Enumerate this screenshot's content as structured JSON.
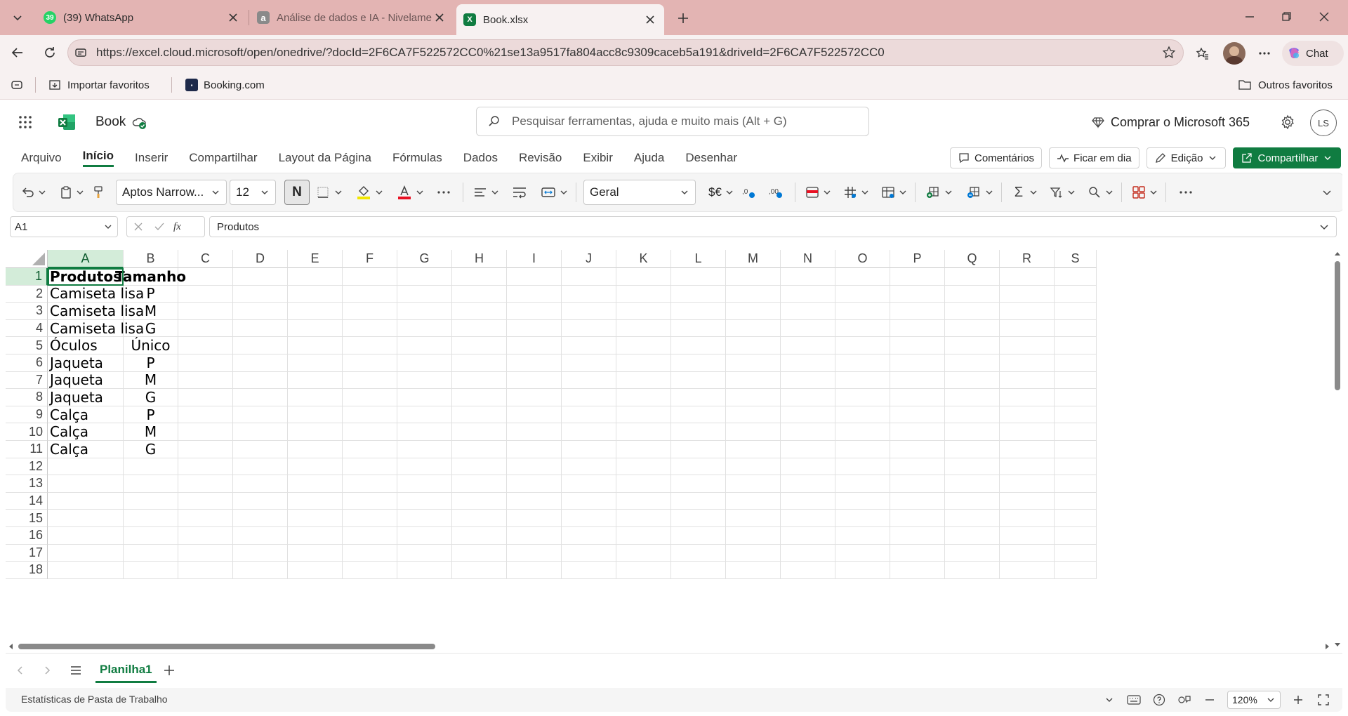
{
  "browser": {
    "tabs": [
      {
        "badge": "39",
        "title": "(39) WhatsApp"
      },
      {
        "title": "Análise de dados e IA - Nivelamen"
      },
      {
        "title": "Book.xlsx"
      }
    ],
    "url": "https://excel.cloud.microsoft/open/onedrive/?docId=2F6CA7F522572CC0%21se13a9517fa804acc8c9309caceb5a191&driveId=2F6CA7F522572CC0",
    "copilot_label": "Chat",
    "favorites": [
      "Importar favoritos",
      "Booking.com"
    ],
    "other_favorites": "Outros favoritos"
  },
  "excel": {
    "doc_title": "Book",
    "search_placeholder": "Pesquisar ferramentas, ajuda e muito mais (Alt + G)",
    "buy_label": "Comprar o Microsoft 365",
    "avatar": "LS",
    "menu": [
      "Arquivo",
      "Início",
      "Inserir",
      "Compartilhar",
      "Layout da Página",
      "Fórmulas",
      "Dados",
      "Revisão",
      "Exibir",
      "Ajuda",
      "Desenhar"
    ],
    "comments_label": "Comentários",
    "catchup_label": "Ficar em dia",
    "editing_label": "Edição",
    "share_label": "Compartilhar",
    "font_name": "Aptos Narrow...",
    "font_size": "12",
    "bold_label": "N",
    "number_format": "Geral",
    "currency_label": "$€",
    "name_box": "A1",
    "formula": "Produtos",
    "fx_label": "fx",
    "columns": [
      "A",
      "B",
      "C",
      "D",
      "E",
      "F",
      "G",
      "H",
      "I",
      "J",
      "K",
      "L",
      "M",
      "N",
      "O",
      "P",
      "Q",
      "R",
      "S"
    ],
    "rows": [
      "1",
      "2",
      "3",
      "4",
      "5",
      "6",
      "7",
      "8",
      "9",
      "10",
      "11",
      "12",
      "13",
      "14",
      "15",
      "16",
      "17",
      "18"
    ],
    "cells": [
      [
        "Produtos",
        "Tamanho"
      ],
      [
        "Camiseta lisa",
        "P"
      ],
      [
        "Camiseta lisa",
        "M"
      ],
      [
        "Camiseta lisa",
        "G"
      ],
      [
        "Óculos",
        "Único"
      ],
      [
        "Jaqueta",
        "P"
      ],
      [
        "Jaqueta",
        "M"
      ],
      [
        "Jaqueta",
        "G"
      ],
      [
        "Calça",
        "P"
      ],
      [
        "Calça",
        "M"
      ],
      [
        "Calça",
        "G"
      ]
    ],
    "sheet_tab": "Planilha1",
    "status_left": "Estatísticas de Pasta de Trabalho",
    "zoom": "120%",
    "brand_color": "#107c41"
  }
}
